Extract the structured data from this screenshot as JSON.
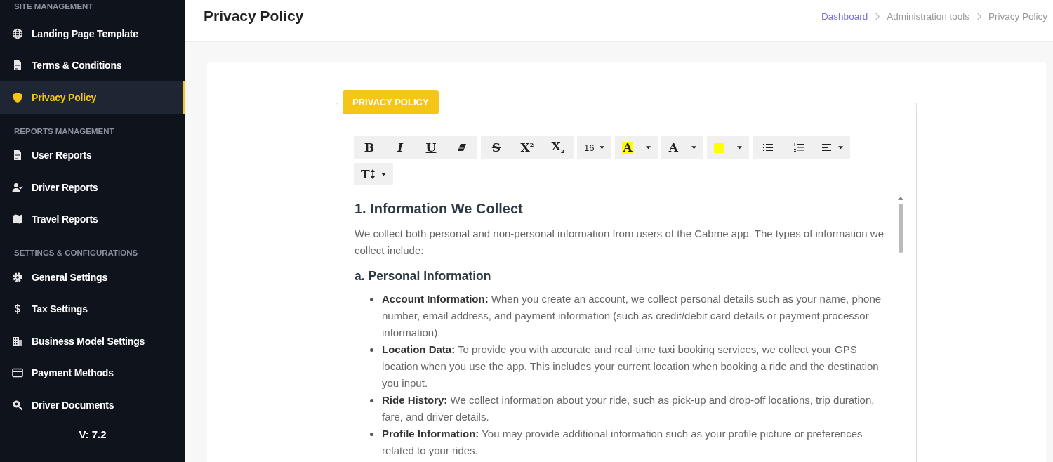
{
  "sidebar": {
    "sections": [
      {
        "title": "SITE MANAGEMENT",
        "items": [
          {
            "label": "Landing Page Template",
            "kind": "globe",
            "selected": false
          },
          {
            "label": "Terms & Conditions",
            "kind": "document",
            "selected": false
          },
          {
            "label": "Privacy Policy",
            "kind": "shield",
            "selected": true
          }
        ]
      },
      {
        "title": "REPORTS MANAGEMENT",
        "items": [
          {
            "label": "User Reports",
            "kind": "document",
            "selected": false
          },
          {
            "label": "Driver Reports",
            "kind": "person",
            "selected": false
          },
          {
            "label": "Travel Reports",
            "kind": "map",
            "selected": false
          }
        ]
      },
      {
        "title": "SETTINGS & CONFIGURATIONS",
        "items": [
          {
            "label": "General Settings",
            "kind": "gear",
            "selected": false
          },
          {
            "label": "Tax Settings",
            "kind": "dollar",
            "selected": false
          },
          {
            "label": "Business Model Settings",
            "kind": "building",
            "selected": false
          },
          {
            "label": "Payment Methods",
            "kind": "card",
            "selected": false
          },
          {
            "label": "Driver Documents",
            "kind": "search",
            "selected": false
          }
        ]
      }
    ],
    "version": "V: 7.2"
  },
  "header": {
    "title": "Privacy Policy",
    "breadcrumb": [
      {
        "label": "Dashboard",
        "kind": "link"
      },
      {
        "label": "Administration tools",
        "kind": "plain"
      },
      {
        "label": "Privacy Policy",
        "kind": "plain"
      }
    ]
  },
  "editor": {
    "legend": "PRIVACY POLICY",
    "toolbar": [
      [
        {
          "kind": "bold",
          "label": "B"
        },
        {
          "kind": "italic",
          "label": "I"
        },
        {
          "kind": "underline",
          "label": "U"
        },
        {
          "kind": "eraser"
        }
      ],
      [
        {
          "kind": "strike",
          "label": "S"
        },
        {
          "kind": "superscript",
          "label": "X$^{2}$"
        },
        {
          "kind": "subscript",
          "label": "X$_{2}$"
        }
      ],
      [
        {
          "kind": "fontsize",
          "label": "16"
        }
      ],
      [
        {
          "kind": "highlight",
          "label": "A",
          "color": "#ffff00"
        }
      ],
      [
        {
          "kind": "fontcolor",
          "label": "A"
        }
      ],
      [
        {
          "kind": "background",
          "color": "#ffff00"
        }
      ],
      [
        {
          "kind": "bullets"
        },
        {
          "kind": "numbers"
        },
        {
          "kind": "align"
        }
      ],
      [
        {
          "kind": "lineheight",
          "label": "T"
        }
      ]
    ],
    "content": [
      {
        "kind": "h1",
        "text": "1. Information We Collect"
      },
      {
        "kind": "p",
        "text": "We collect both personal and non-personal information from users of the Cabme app. The types of information we collect include:"
      },
      {
        "kind": "h2",
        "text": "a. Personal Information"
      },
      {
        "kind": "ul",
        "items": [
          "**Account Information:** When you create an account, we collect personal details such as your name, phone number, email address, and payment information (such as credit/debit card details or payment processor information).",
          "**Location Data:** To provide you with accurate and real-time taxi booking services, we collect your GPS location when you use the app. This includes your current location when booking a ride and the destination you input.",
          "**Ride History:** We collect information about your ride, such as pick-up and drop-off locations, trip duration, fare, and driver details.",
          "**Profile Information:** You may provide additional information such as your profile picture or preferences related to your rides."
        ]
      }
    ]
  }
}
